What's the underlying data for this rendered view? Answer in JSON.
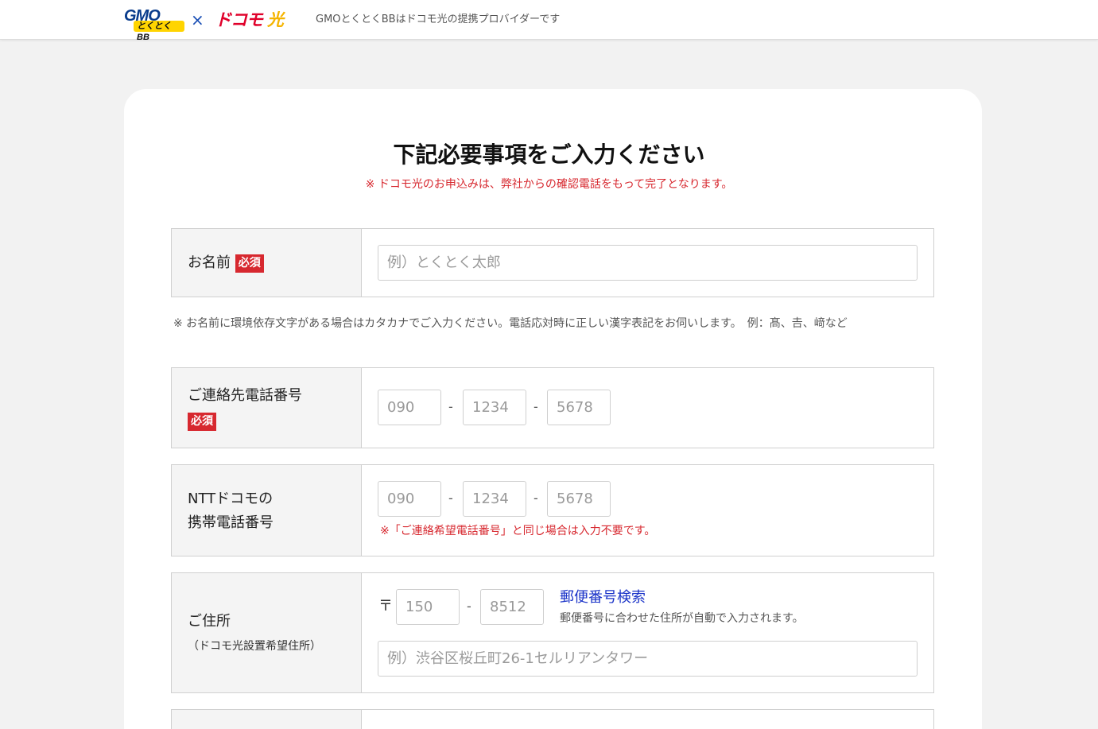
{
  "header": {
    "logo_gmo": "GMO",
    "logo_tokutoku": "とくとくBB",
    "logo_x": "×",
    "logo_docomo": "ドコモ",
    "logo_hikari": "光",
    "provider_note": "GMOとくとくBBはドコモ光の提携プロバイダーです"
  },
  "form": {
    "title": "下記必要事項をご入力ください",
    "subnote": "※ ドコモ光のお申込みは、弊社からの確認電話をもって完了となります。",
    "required_badge": "必須",
    "name": {
      "label": "お名前",
      "placeholder": "例）とくとく太郎"
    },
    "name_note": "※ お名前に環境依存文字がある場合はカタカナでご入力ください。電話応対時に正しい漢字表記をお伺いします。　例：髙、𠮷、﨑など",
    "contact_phone": {
      "label": "ご連絡先電話番号",
      "placeholders": [
        "090",
        "1234",
        "5678"
      ],
      "dash": "-"
    },
    "docomo_phone": {
      "label_line1": "NTTドコモの",
      "label_line2": "携帯電話番号",
      "placeholders": [
        "090",
        "1234",
        "5678"
      ],
      "note": "※「ご連絡希望電話番号」と同じ場合は入力不要です。"
    },
    "address": {
      "label": "ご住所",
      "sublabel": "（ドコモ光設置希望住所）",
      "postmark": "〒",
      "zip_placeholders": [
        "150",
        "8512"
      ],
      "zip_search_link": "郵便番号検索",
      "zip_help": "郵便番号に合わせた住所が自動で入力されます。",
      "address_placeholder": "例）渋谷区桜丘町26-1セルリアンタワー"
    }
  },
  "colors": {
    "accent_red": "#d7282f",
    "link_blue": "#1a33c8",
    "page_bg": "#f2f2f2"
  }
}
